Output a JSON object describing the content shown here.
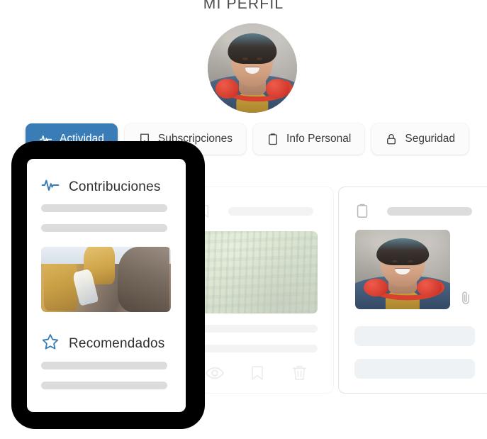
{
  "page": {
    "title": "MI PERFIL",
    "background_color": "#ffffff"
  },
  "avatar": {
    "alt": "Foto de perfil de usuario con auriculares rojos y chaqueta vaquera",
    "shape": "circle"
  },
  "tabs": [
    {
      "label": "Actividad",
      "icon": "activity-pulse-icon",
      "active": true,
      "accent_color": "#3a7cb5"
    },
    {
      "label": "Subscripciones",
      "icon": "bookmark-icon",
      "active": false,
      "accent_color": "#fbfbfb"
    },
    {
      "label": "Info Personal",
      "icon": "clipboard-icon",
      "active": false,
      "accent_color": "#fbfbfb"
    },
    {
      "label": "Seguridad",
      "icon": "lock-icon",
      "active": false,
      "accent_color": "#fbfbfb"
    }
  ],
  "front_card": {
    "sections": [
      {
        "title": "Contribuciones",
        "icon": "activity-pulse-icon",
        "icon_color": "#3a7cb5",
        "placeholder_bars": 2,
        "image_alt": "Personas con guantes amarillos recogiendo botellas de plastico"
      },
      {
        "title": "Recomendados",
        "icon": "star-icon",
        "icon_color": "#3a7cb5",
        "placeholder_bars": 2
      }
    ]
  },
  "middle_card": {
    "header_icon": "bookmark-icon",
    "header_bar": true,
    "image_alt": "Bosque de pinos visto desde arriba",
    "placeholder_bars": 2,
    "actions": [
      {
        "icon": "eye-icon",
        "label": "Ver"
      },
      {
        "icon": "bookmark-icon",
        "label": "Guardar"
      },
      {
        "icon": "trash-icon",
        "label": "Eliminar"
      }
    ]
  },
  "right_card": {
    "header_icon": "clipboard-icon",
    "header_bar": true,
    "image_alt": "Retrato de usuario con auriculares rojos",
    "attachment_icon": "paperclip-icon",
    "fields": 2
  },
  "colors": {
    "accent": "#3a7cb5",
    "skeleton": "#dcdcdc",
    "field": "#eef2f4",
    "card_border": "#e3e3e3",
    "frame": "#000000",
    "text": "#2f2f2f",
    "title": "#4a4a4a"
  }
}
